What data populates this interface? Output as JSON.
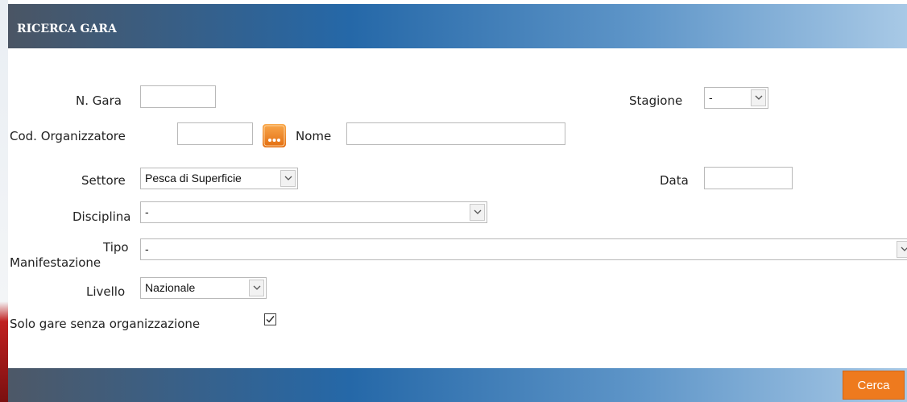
{
  "header": {
    "title": "RICERCA GARA"
  },
  "form": {
    "n_gara": {
      "label": "N. Gara",
      "value": ""
    },
    "stagione": {
      "label": "Stagione",
      "selected": "-"
    },
    "cod_organizzatore": {
      "label": "Cod. Organizzatore",
      "value": ""
    },
    "lookup_icon": "ellipsis-lookup-icon",
    "nome": {
      "label": "Nome",
      "value": ""
    },
    "settore": {
      "label": "Settore",
      "selected": "Pesca di Superficie"
    },
    "data": {
      "label": "Data",
      "value": ""
    },
    "disciplina": {
      "label": "Disciplina",
      "selected": "-"
    },
    "tipo_manifestazione": {
      "label_line1": "Tipo",
      "label_line2": "Manifestazione",
      "selected": "-"
    },
    "livello": {
      "label": "Livello",
      "selected": "Nazionale"
    },
    "solo_gare": {
      "label": "Solo gare senza organizzazione",
      "checked": true
    }
  },
  "footer": {
    "cerca_label": "Cerca"
  },
  "colors": {
    "accent_button": "#ee7a1e",
    "header_start": "#4a5564",
    "header_mid": "#2568a8",
    "header_end": "#a8c9e6"
  }
}
